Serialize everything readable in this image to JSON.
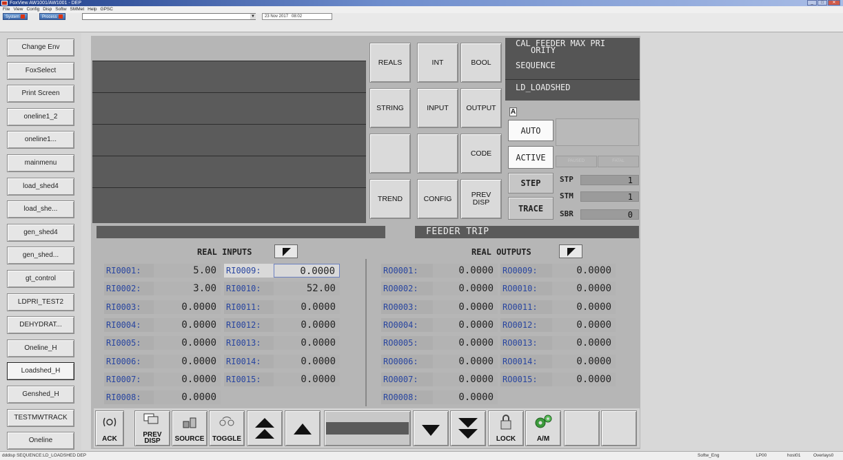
{
  "window": {
    "title": "FoxView AW1001/AW1001 - DEP"
  },
  "menu": [
    "File",
    "View",
    "Config",
    "Disp",
    "Softw",
    "SMMet",
    "Help",
    "GPSC"
  ],
  "toolbar": {
    "system_label": "System",
    "process_label": "Process",
    "date": "23 Nov 2017",
    "time": "08:02"
  },
  "nav": [
    "Change Env",
    "FoxSelect",
    "Print Screen",
    "oneline1_2",
    "oneline1...",
    "mainmenu",
    "load_shed4",
    "load_she...",
    "gen_shed4",
    "gen_shed...",
    "gt_control",
    "LDPRI_TEST2",
    "DEHYDRAT...",
    "Oneline_H",
    "Loadshed_H",
    "Genshed_H",
    "TESTMWTRACK",
    "Oneline"
  ],
  "nav_selected": "Loadshed_H",
  "grid_buttons": [
    "REALS",
    "INT",
    "BOOL",
    "STRING",
    "INPUT",
    "OUTPUT",
    "",
    "",
    "CODE",
    "TREND",
    "CONFIG",
    "PREV DISP"
  ],
  "block": {
    "name": "CAL FEEDER MAX PRIORITY",
    "name_line1": "CAL FEEDER MAX PRI",
    "name_line2": "ORITY",
    "type": "SEQUENCE",
    "compound": "LD_LOADSHED",
    "am_indicator": "A",
    "auto": "AUTO",
    "active": "ACTIVE",
    "step": "STEP",
    "trace": "TRACE",
    "paused_label": "PAUSED",
    "fatal_label": "FATAL"
  },
  "status": [
    {
      "label": "STP",
      "value": "1"
    },
    {
      "label": "STM",
      "value": "1"
    },
    {
      "label": "SBR",
      "value": "0"
    }
  ],
  "description": "FEEDER TRIP",
  "inputs": {
    "header": "REAL  INPUTS",
    "col1": [
      {
        "label": "RI0001:",
        "value": "5.00"
      },
      {
        "label": "RI0002:",
        "value": "3.00"
      },
      {
        "label": "RI0003:",
        "value": "0.0000"
      },
      {
        "label": "RI0004:",
        "value": "0.0000"
      },
      {
        "label": "RI0005:",
        "value": "0.0000"
      },
      {
        "label": "RI0006:",
        "value": "0.0000"
      },
      {
        "label": "RI0007:",
        "value": "0.0000"
      },
      {
        "label": "RI0008:",
        "value": "0.0000"
      }
    ],
    "col2": [
      {
        "label": "RI0009:",
        "value": "0.0000"
      },
      {
        "label": "RI0010:",
        "value": "52.00"
      },
      {
        "label": "RI0011:",
        "value": "0.0000"
      },
      {
        "label": "RI0012:",
        "value": "0.0000"
      },
      {
        "label": "RI0013:",
        "value": "0.0000"
      },
      {
        "label": "RI0014:",
        "value": "0.0000"
      },
      {
        "label": "RI0015:",
        "value": "0.0000"
      }
    ]
  },
  "outputs": {
    "header": "REAL  OUTPUTS",
    "col1": [
      {
        "label": "RO0001:",
        "value": "0.0000"
      },
      {
        "label": "RO0002:",
        "value": "0.0000"
      },
      {
        "label": "RO0003:",
        "value": "0.0000"
      },
      {
        "label": "RO0004:",
        "value": "0.0000"
      },
      {
        "label": "RO0005:",
        "value": "0.0000"
      },
      {
        "label": "RO0006:",
        "value": "0.0000"
      },
      {
        "label": "RO0007:",
        "value": "0.0000"
      },
      {
        "label": "RO0008:",
        "value": "0.0000"
      }
    ],
    "col2": [
      {
        "label": "RO0009:",
        "value": "0.0000"
      },
      {
        "label": "RO0010:",
        "value": "0.0000"
      },
      {
        "label": "RO0011:",
        "value": "0.0000"
      },
      {
        "label": "RO0012:",
        "value": "0.0000"
      },
      {
        "label": "RO0013:",
        "value": "0.0000"
      },
      {
        "label": "RO0014:",
        "value": "0.0000"
      },
      {
        "label": "RO0015:",
        "value": "0.0000"
      }
    ]
  },
  "bottom": {
    "ack": "ACK",
    "prev_disp_1": "PREV",
    "prev_disp_2": "DISP",
    "source": "SOURCE",
    "toggle": "TOGGLE",
    "lock": "LOCK",
    "am": "A/M"
  },
  "statusbar": {
    "left": "dddisp SEQUENCE:LD_LOADSHED DEP",
    "softw": "Softw_Eng",
    "lp": "LP00",
    "host": "host01",
    "overlays": "Overlays0"
  },
  "colors": {
    "panel_dark": "#5b5b5b",
    "tag_blue": "#2845a0",
    "background": "#d8d8d8"
  }
}
